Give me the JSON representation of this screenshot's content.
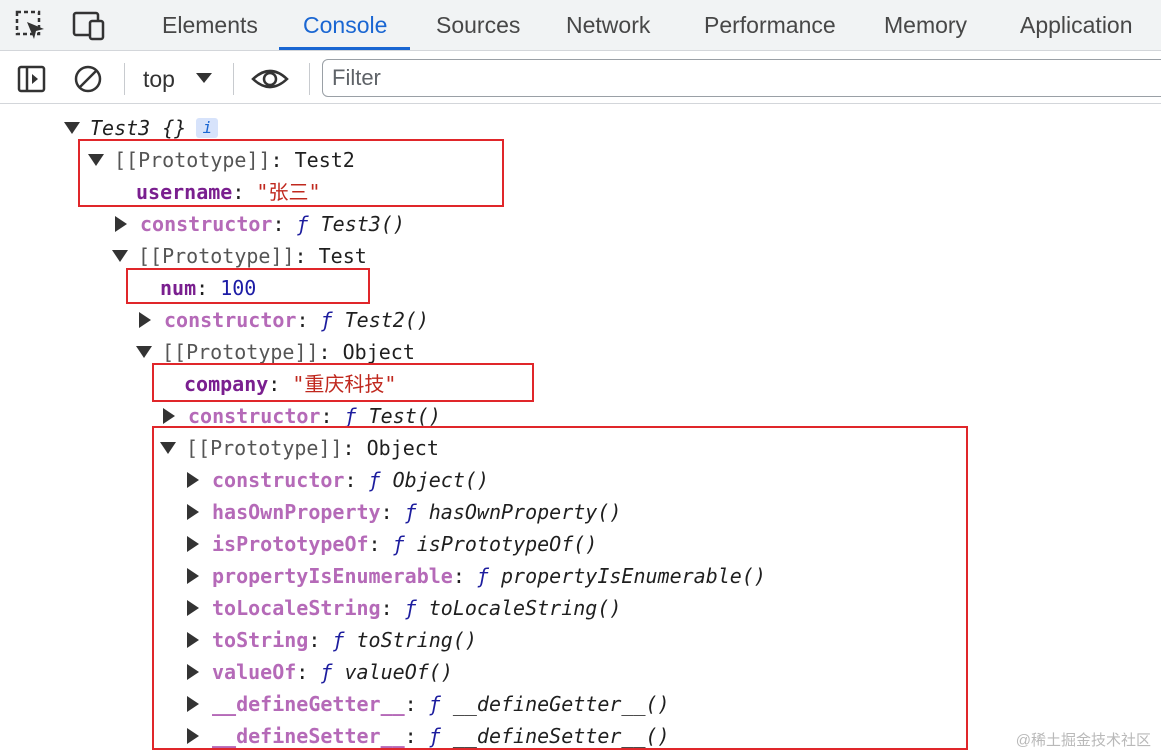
{
  "tabs": [
    {
      "label": "Elements"
    },
    {
      "label": "Console"
    },
    {
      "label": "Sources"
    },
    {
      "label": "Network"
    },
    {
      "label": "Performance"
    },
    {
      "label": "Memory"
    },
    {
      "label": "Application"
    }
  ],
  "toolbar": {
    "context": "top",
    "filter_placeholder": "Filter"
  },
  "tree": {
    "root": {
      "name": "Test3",
      "braces": "{}",
      "info": "i"
    },
    "r1": {
      "proto": "[[Prototype]]",
      "colon": ": ",
      "type": "Test2"
    },
    "username": {
      "key": "username",
      "value": "\"张三\""
    },
    "ctor_test3": {
      "key": "constructor",
      "f": "ƒ",
      "fn": "Test3()"
    },
    "r2": {
      "proto": "[[Prototype]]",
      "colon": ": ",
      "type": "Test"
    },
    "num": {
      "key": "num",
      "value": "100"
    },
    "ctor_test2": {
      "key": "constructor",
      "f": "ƒ",
      "fn": "Test2()"
    },
    "r3": {
      "proto": "[[Prototype]]",
      "colon": ": ",
      "type": "Object"
    },
    "company": {
      "key": "company",
      "value": "\"重庆科技\""
    },
    "ctor_test": {
      "key": "constructor",
      "f": "ƒ",
      "fn": "Test()"
    },
    "r4": {
      "proto": "[[Prototype]]",
      "colon": ": ",
      "type": "Object"
    },
    "object_members": [
      {
        "key": "constructor",
        "f": "ƒ",
        "fn": "Object()"
      },
      {
        "key": "hasOwnProperty",
        "f": "ƒ",
        "fn": "hasOwnProperty()"
      },
      {
        "key": "isPrototypeOf",
        "f": "ƒ",
        "fn": "isPrototypeOf()"
      },
      {
        "key": "propertyIsEnumerable",
        "f": "ƒ",
        "fn": "propertyIsEnumerable()"
      },
      {
        "key": "toLocaleString",
        "f": "ƒ",
        "fn": "toLocaleString()"
      },
      {
        "key": "toString",
        "f": "ƒ",
        "fn": "toString()"
      },
      {
        "key": "valueOf",
        "f": "ƒ",
        "fn": "valueOf()"
      },
      {
        "key": "__defineGetter__",
        "f": "ƒ",
        "fn": "__defineGetter__()"
      },
      {
        "key": "__defineSetter__",
        "f": "ƒ",
        "fn": "__defineSetter__()"
      }
    ]
  },
  "watermark": "@稀土掘金技术社区",
  "colors": {
    "accent": "#1a66d2",
    "highlight_box": "#e0262a",
    "key": "#7a1f8f",
    "string": "#c0281e"
  }
}
